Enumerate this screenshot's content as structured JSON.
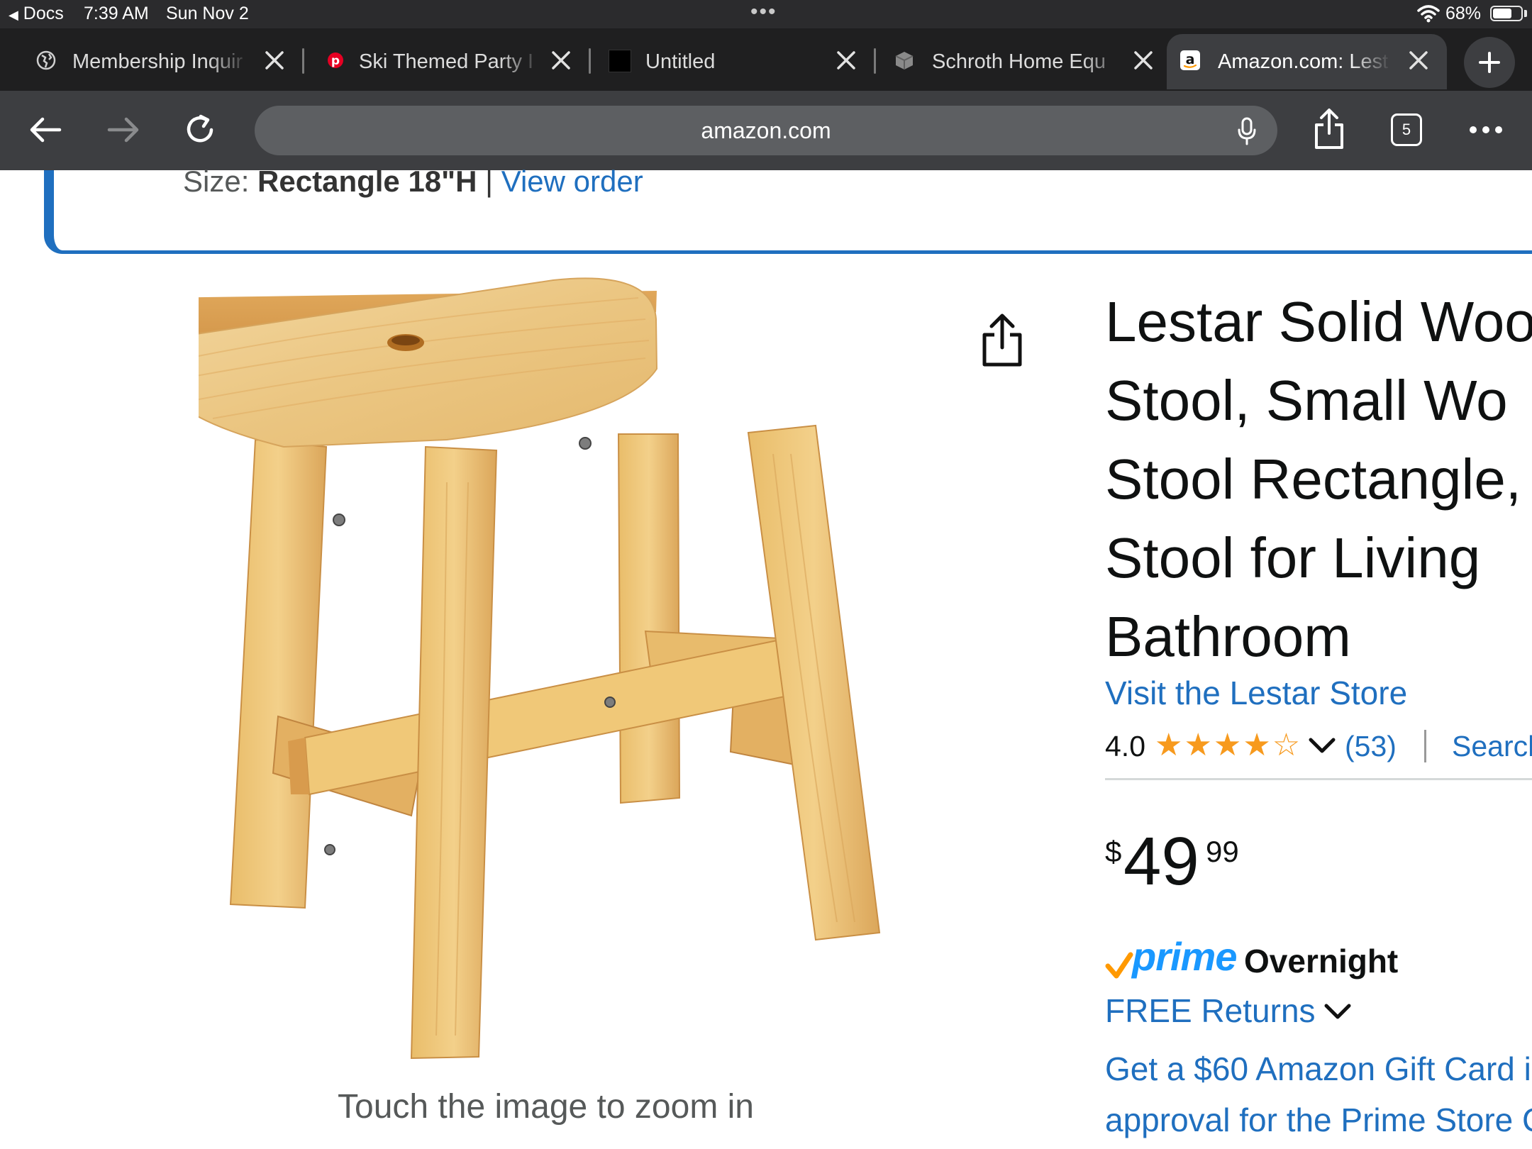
{
  "status_bar": {
    "back_app": "Docs",
    "time": "7:39 AM",
    "date": "Sun Nov 2",
    "battery": "68%",
    "battery_level": 0.68
  },
  "tabs": [
    {
      "label": "Membership Inquir",
      "icon": "globe-icon",
      "active": false
    },
    {
      "label": "Ski Themed Party I",
      "icon": "pinterest-icon",
      "active": false
    },
    {
      "label": "Untitled",
      "icon": "black-square-icon",
      "active": false
    },
    {
      "label": "Schroth Home Equ",
      "icon": "cube-icon",
      "active": false
    },
    {
      "label": "Amazon.com: Lest",
      "icon": "amazon-icon",
      "active": true
    }
  ],
  "toolbar": {
    "url": "amazon.com",
    "tab_count": "5"
  },
  "order_banner": {
    "size_label": "Size:",
    "size_value": "Rectangle 18\"H",
    "separator": "|",
    "view_order": "View order"
  },
  "product": {
    "image_alt": "Wooden stool",
    "zoom_hint": "Touch the image to zoom in",
    "title_lines": [
      "Lestar Solid Woo",
      "Stool, Small Wo",
      "Stool Rectangle,",
      "Stool for Living",
      "Bathroom"
    ],
    "store_link": "Visit the Lestar Store",
    "rating": "4.0",
    "rating_value": 4.0,
    "stars": "★★★★☆",
    "review_count": "(53)",
    "search_link": "Search",
    "price_symbol": "$",
    "price_whole": "49",
    "price_fraction": "99",
    "prime_label": "prime",
    "prime_speed": "Overnight",
    "free_returns": "FREE Returns",
    "gift_line1": "Get a $60 Amazon Gift Card i",
    "gift_line2": "approval for the Prime Store C"
  },
  "colors": {
    "link": "#1f6fbf",
    "star": "#f79a1e",
    "prime_blue": "#1a98ff",
    "prime_check": "#ff9900",
    "toolbar": "#3d3e41",
    "tabbar": "#1f1f20"
  }
}
